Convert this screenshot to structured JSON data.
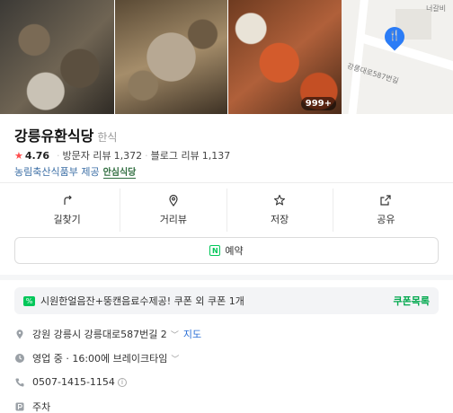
{
  "photos": {
    "count_badge": "999+"
  },
  "map": {
    "label_top": "너갈비",
    "label_road": "강릉대로587번길"
  },
  "place": {
    "name": "강릉유환식당",
    "category": "한식",
    "rating": "4.76",
    "visitor_reviews_label": "방문자 리뷰",
    "visitor_reviews_count": "1,372",
    "blog_reviews_label": "블로그 리뷰",
    "blog_reviews_count": "1,137",
    "certification_text": "농림축산식품부 제공",
    "certification_logo": "안심식당"
  },
  "actions": [
    {
      "label": "길찾기",
      "icon": "directions-icon"
    },
    {
      "label": "거리뷰",
      "icon": "street-view-icon"
    },
    {
      "label": "저장",
      "icon": "star-icon"
    },
    {
      "label": "공유",
      "icon": "share-icon"
    }
  ],
  "reserve": {
    "label": "예약",
    "icon_text": "N"
  },
  "coupon": {
    "icon_text": "%",
    "text": "시원한얼음잔+뚱캔음료수제공! 쿠폰 외 쿠폰 1개",
    "link": "쿠폰목록"
  },
  "info": {
    "address": "강원 강릉시 강릉대로587번길 2",
    "map_link": "지도",
    "hours": "영업 중 · 16:00에 브레이크타임",
    "phone": "0507-1415-1154",
    "info_glyph": "i",
    "parking": "주차"
  },
  "colors": {
    "accent_green": "#03c75a",
    "link_blue": "#2b6fd6",
    "star_red": "#ff4d4d"
  }
}
